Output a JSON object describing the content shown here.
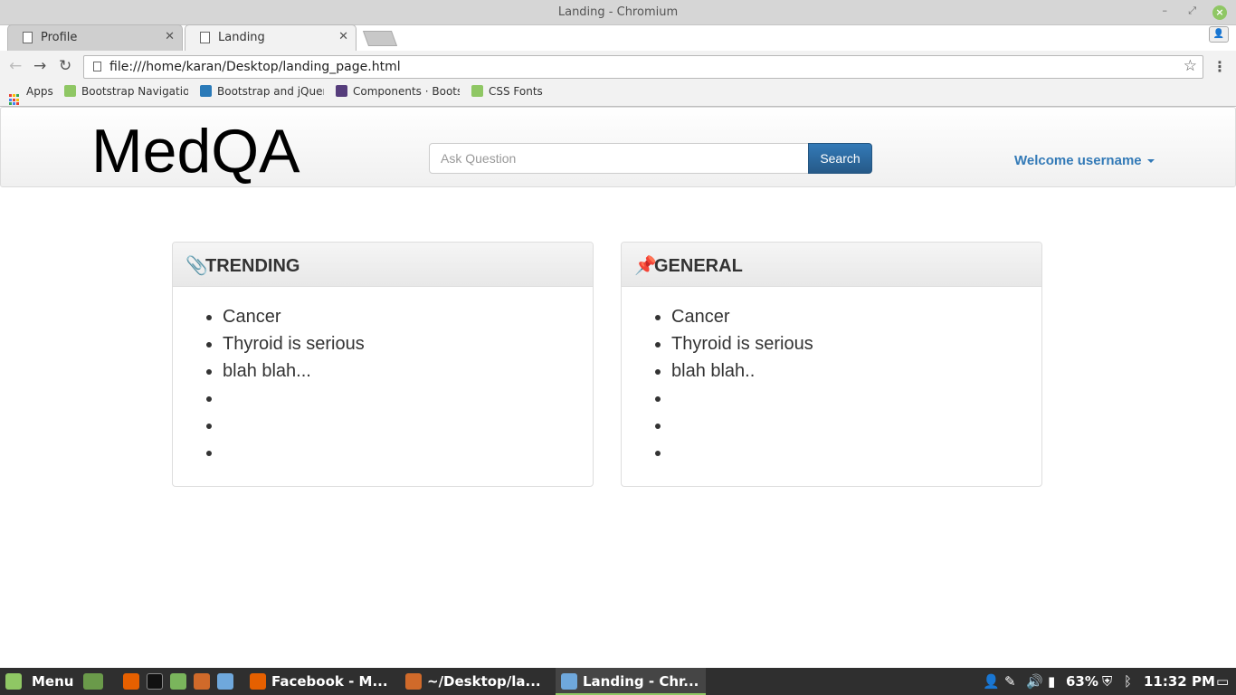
{
  "window": {
    "title": "Landing - Chromium"
  },
  "tabs": [
    {
      "label": "Profile",
      "active": false
    },
    {
      "label": "Landing",
      "active": true
    }
  ],
  "address_bar": {
    "url": "file:///home/karan/Desktop/landing_page.html"
  },
  "bookmarks": [
    {
      "label": "Apps"
    },
    {
      "label": "Bootstrap Navigation"
    },
    {
      "label": "Bootstrap and jQuery"
    },
    {
      "label": "Components · Bootstrap"
    },
    {
      "label": "CSS Fonts"
    }
  ],
  "page": {
    "brand": "MedQA",
    "search": {
      "placeholder": "Ask Question",
      "button_label": "Search"
    },
    "user_menu": {
      "label": "Welcome username"
    },
    "panels": [
      {
        "title": "TRENDING",
        "icon": "paperclip-icon",
        "items": [
          "Cancer",
          "Thyroid is serious",
          "blah blah...",
          "",
          "",
          ""
        ]
      },
      {
        "title": "GENERAL",
        "icon": "pushpin-icon",
        "items": [
          "Cancer",
          "Thyroid is serious",
          "blah blah..",
          "",
          "",
          ""
        ]
      }
    ]
  },
  "taskbar": {
    "menu_label": "Menu",
    "tasks": [
      {
        "label": "Facebook - M...",
        "active": false
      },
      {
        "label": "~/Desktop/la...",
        "active": false
      },
      {
        "label": "Landing - Chr...",
        "active": true
      }
    ],
    "battery": "63%",
    "clock": "11:32 PM"
  },
  "colors": {
    "accent": "#337ab7",
    "mint_green": "#8fc764"
  }
}
